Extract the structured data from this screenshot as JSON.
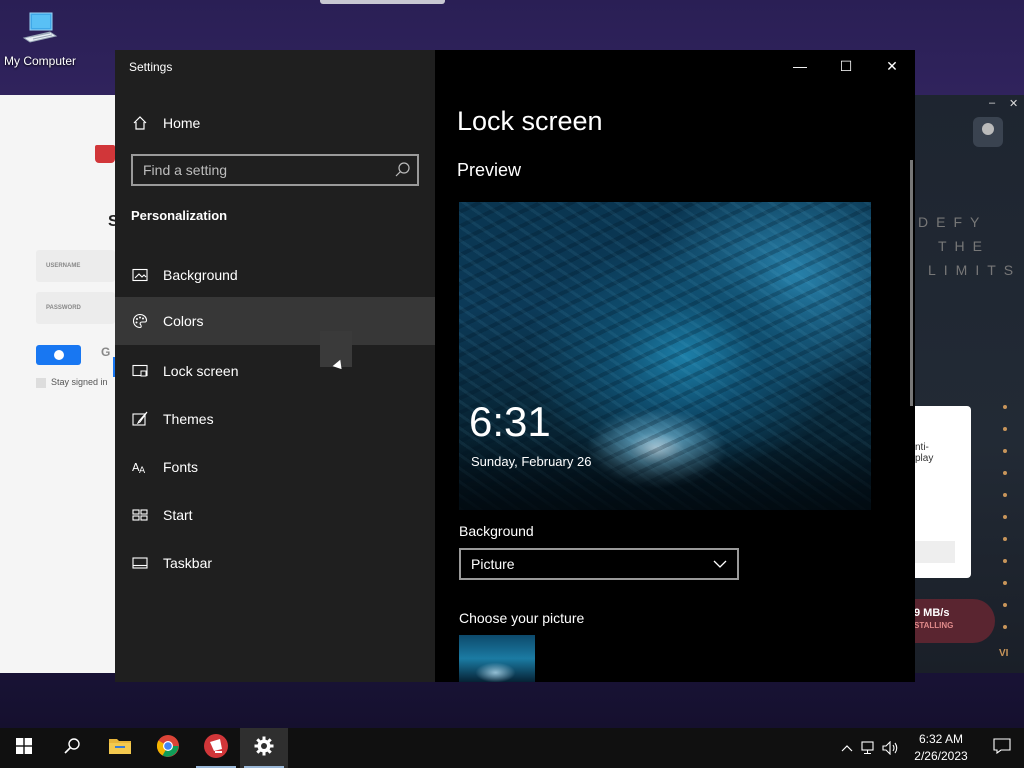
{
  "desktop": {
    "icons": [
      {
        "label": "My Computer",
        "icon": "computer-icon"
      }
    ]
  },
  "background_app": {
    "login": {
      "username_label": "USERNAME",
      "password_label": "PASSWORD",
      "stay_signed_in": "Stay signed in",
      "heading_partial": "S",
      "google_partial": "G"
    },
    "side": {
      "tagline": [
        "DEFY",
        "THE",
        "LIMITS"
      ],
      "card_text": [
        "nti-",
        "play"
      ],
      "speed": "9 MB/s",
      "status": "STALLING",
      "badge": "VI"
    }
  },
  "window": {
    "title": "Settings",
    "controls": {
      "minimize": "—",
      "maximize": "☐",
      "close": "✕"
    }
  },
  "nav": {
    "home": {
      "label": "Home",
      "icon": "home-icon"
    },
    "search": {
      "placeholder": "Find a setting"
    },
    "section": "Personalization",
    "items": [
      {
        "label": "Background",
        "icon": "picture-icon",
        "selected": false
      },
      {
        "label": "Colors",
        "icon": "palette-icon",
        "selected": true
      },
      {
        "label": "Lock screen",
        "icon": "lock-screen-icon",
        "selected": false
      },
      {
        "label": "Themes",
        "icon": "brush-icon",
        "selected": false
      },
      {
        "label": "Fonts",
        "icon": "fonts-icon",
        "selected": false
      },
      {
        "label": "Start",
        "icon": "start-layout-icon",
        "selected": false
      },
      {
        "label": "Taskbar",
        "icon": "taskbar-icon",
        "selected": false
      }
    ]
  },
  "content": {
    "title": "Lock screen",
    "preview_heading": "Preview",
    "preview": {
      "time": "6:31",
      "date": "Sunday, February 26"
    },
    "background_label": "Background",
    "background_value": "Picture",
    "choose_label": "Choose your picture"
  },
  "taskbar": {
    "apps": [
      {
        "name": "start-button",
        "icon": "windows-icon"
      },
      {
        "name": "search-button",
        "icon": "search-icon"
      },
      {
        "name": "file-explorer",
        "icon": "folder-icon"
      },
      {
        "name": "chrome",
        "icon": "chrome-icon"
      },
      {
        "name": "riot-client",
        "icon": "riot-icon"
      },
      {
        "name": "settings",
        "icon": "gear-icon"
      }
    ],
    "clock": {
      "time": "6:32 AM",
      "date": "2/26/2023"
    }
  }
}
